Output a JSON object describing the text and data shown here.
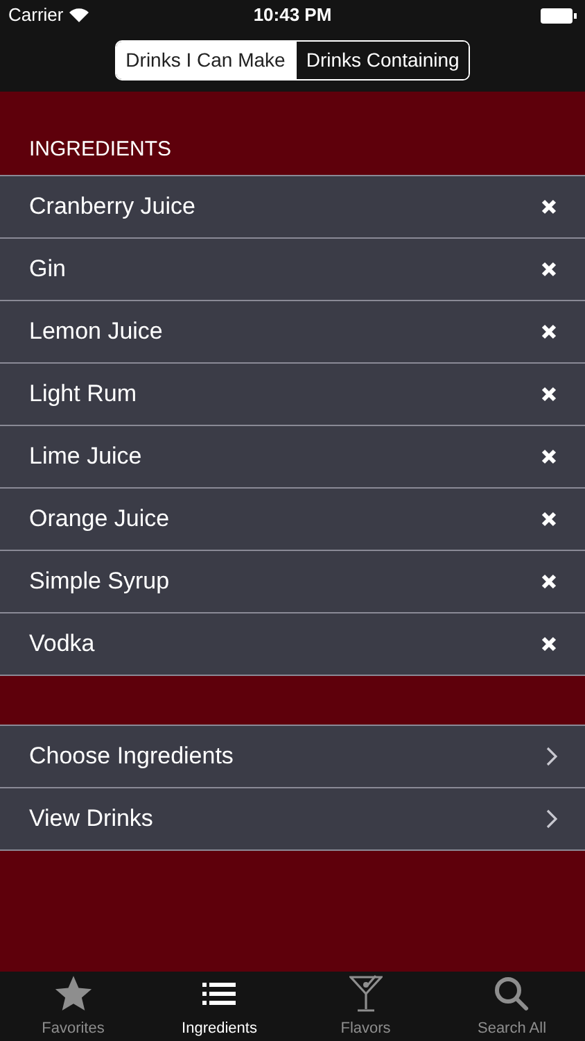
{
  "status_bar": {
    "carrier": "Carrier",
    "time": "10:43 PM"
  },
  "segments": [
    {
      "label": "Drinks I Can Make",
      "selected": true
    },
    {
      "label": "Drinks Containing",
      "selected": false
    }
  ],
  "section_title": "INGREDIENTS",
  "ingredients": [
    "Cranberry Juice",
    "Gin",
    "Lemon Juice",
    "Light Rum",
    "Lime Juice",
    "Orange Juice",
    "Simple Syrup",
    "Vodka"
  ],
  "actions": [
    "Choose Ingredients",
    "View Drinks"
  ],
  "tabs": [
    {
      "label": "Favorites",
      "kind": "star",
      "selected": false
    },
    {
      "label": "Ingredients",
      "kind": "list",
      "selected": true
    },
    {
      "label": "Flavors",
      "kind": "glass",
      "selected": false
    },
    {
      "label": "Search All",
      "kind": "search",
      "selected": false
    }
  ]
}
